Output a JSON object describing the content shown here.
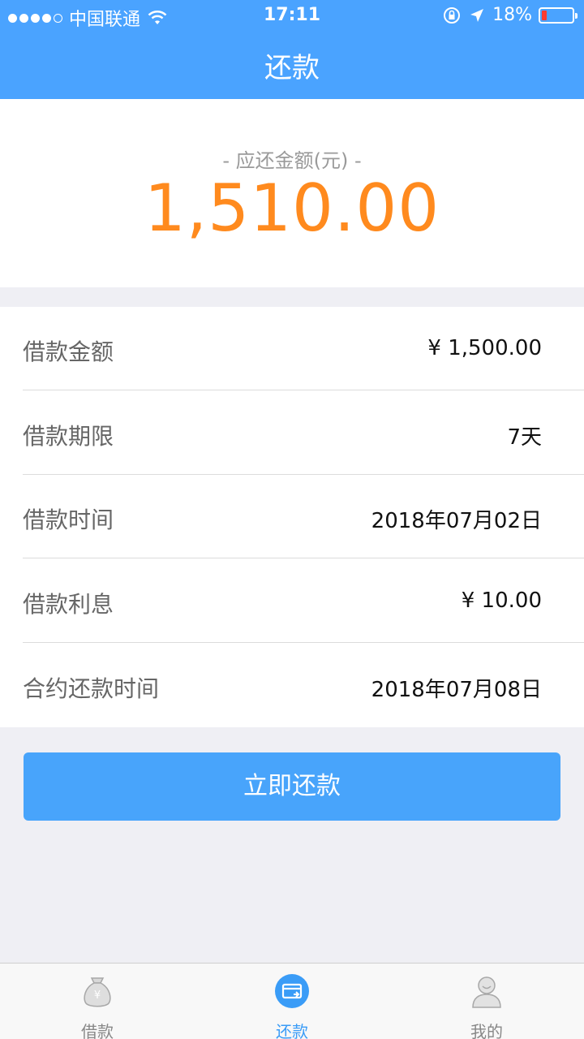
{
  "status_bar": {
    "carrier": "中国联通",
    "time": "17:11",
    "battery_percent": "18%",
    "battery_level": 0.18
  },
  "nav": {
    "title": "还款"
  },
  "amount": {
    "label": "- 应还金额(元) -",
    "value": "1,510.00"
  },
  "details": [
    {
      "label": "借款金额",
      "value": "¥ 1,500.00"
    },
    {
      "label": "借款期限",
      "value": "7天"
    },
    {
      "label": "借款时间",
      "value": "2018年07月02日"
    },
    {
      "label": "借款利息",
      "value": "¥ 10.00"
    },
    {
      "label": "合约还款时间",
      "value": "2018年07月08日"
    }
  ],
  "actions": {
    "pay_now": "立即还款"
  },
  "tabs": [
    {
      "label": "借款",
      "icon": "money-bag-icon",
      "active": false
    },
    {
      "label": "还款",
      "icon": "repay-card-icon",
      "active": true
    },
    {
      "label": "我的",
      "icon": "user-icon",
      "active": false
    }
  ],
  "colors": {
    "header": "#4aa3ff",
    "amount": "#ff8a1e",
    "button": "#48a4fb",
    "active_tab": "#3a9cf7"
  }
}
